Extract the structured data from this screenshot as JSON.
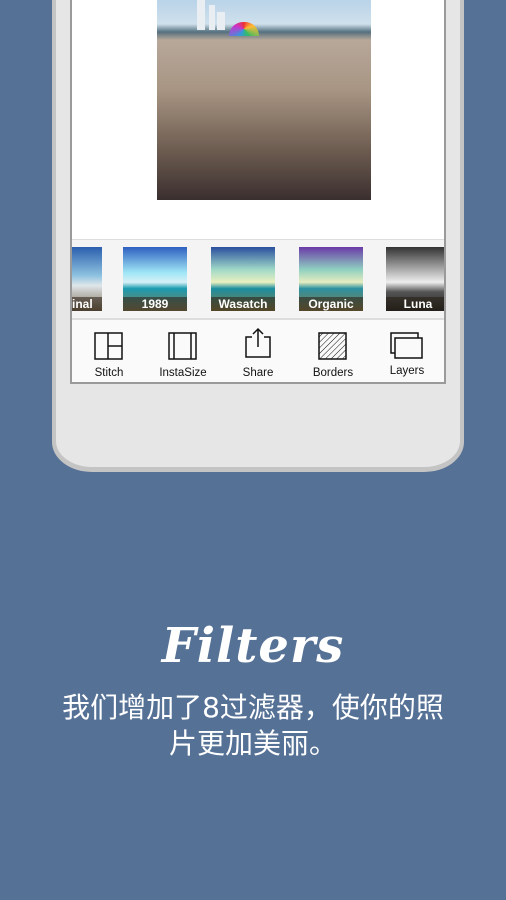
{
  "filters": [
    {
      "label": "Original",
      "gradient": "linear-gradient(180deg,#2b5fae,#8fc3e0 45%,#dfe6ea 60%,#7a6a50)"
    },
    {
      "label": "1989",
      "gradient": "linear-gradient(180deg,#2e5fc0,#9fe6f6 40%,#d6f0f6 55%,#1b9bb0 65%,#8b7a50)"
    },
    {
      "label": "Wasatch",
      "gradient": "linear-gradient(180deg,#2a4f9e,#9fd8c8 35%,#eaf0c0 55%,#1b8ea0 65%,#8a7a40)"
    },
    {
      "label": "Organic",
      "gradient": "linear-gradient(180deg,#6a3aa8,#8fd0c0 35%,#e6ecc0 55%,#2b90a0 65%,#8c7a44)"
    },
    {
      "label": "Luna",
      "gradient": "linear-gradient(180deg,#333,#bbb 40%,#eee 55%,#555 70%,#222)"
    }
  ],
  "toolbar": {
    "stitch": "Stitch",
    "instasize": "InstaSize",
    "share": "Share",
    "borders": "Borders",
    "layers": "Layers"
  },
  "headline": "Filters",
  "description": "我们增加了8过滤器，使你的照片更加美丽。",
  "colors": {
    "background": "#557195",
    "phone": "#e6e6e6"
  }
}
